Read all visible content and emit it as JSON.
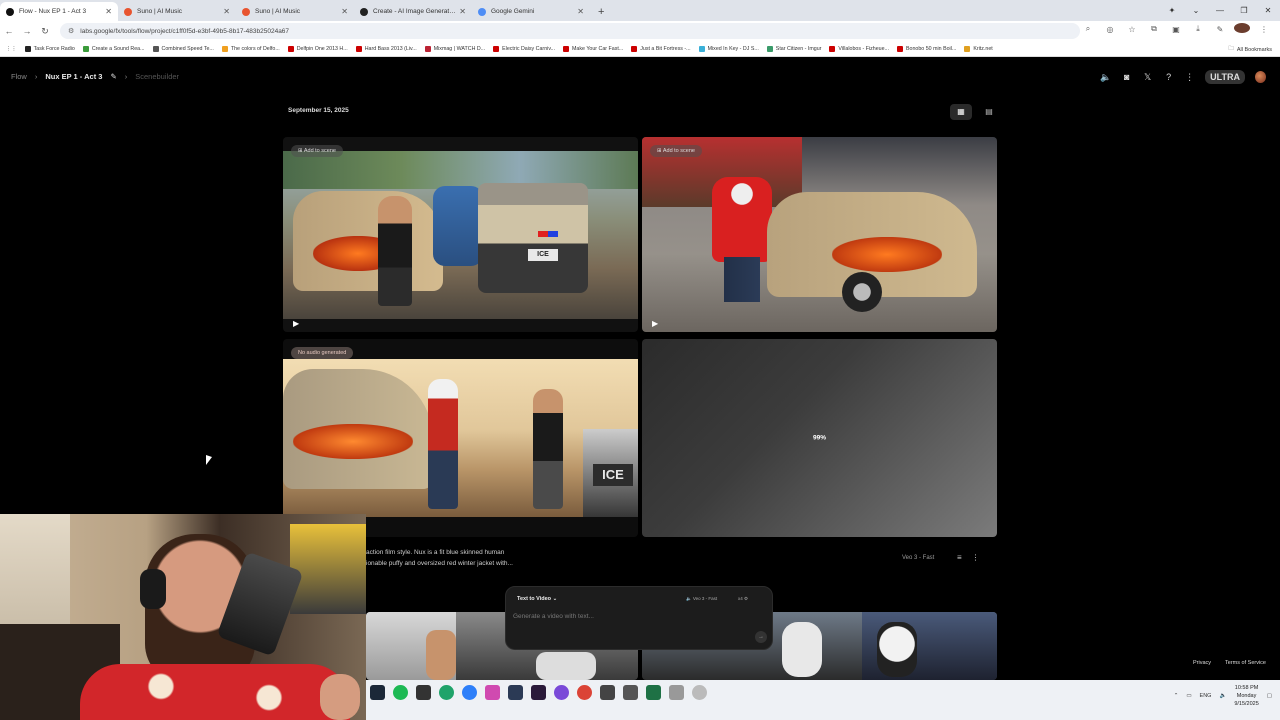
{
  "browser": {
    "tabs": [
      {
        "title": "Flow - Nux EP 1 - Act 3",
        "color": "#111111",
        "active": true
      },
      {
        "title": "Suno | AI Music",
        "color": "#e8542f",
        "active": false
      },
      {
        "title": "Suno | AI Music",
        "color": "#e8542f",
        "active": false
      },
      {
        "title": "Create - AI Image Generator | ...",
        "color": "#222222",
        "active": false
      },
      {
        "title": "Google Gemini",
        "color": "#4e8df5",
        "active": false
      }
    ],
    "new_tab": "+",
    "url": "labs.google/fx/tools/flow/project/c1ff0f5d-e3bf-49b5-8b17-483b25024a67",
    "bookmarks": [
      "Task Force Radio",
      "Create a Sound Rea...",
      "Combined Speed Te...",
      "The colors of Delfo...",
      "Delfpin One 2013 H...",
      "Hard Bass 2013 (Liv...",
      "Mixmag | WATCH D...",
      "Electric Daisy Carniv...",
      "Make Your Car Fast...",
      "Just a Bit Fortress -...",
      "Mixed In Key - DJ S...",
      "Star Citizen - Imgur",
      "Villalobos - Fizheue...",
      "Bonobo 50 min Boil...",
      "Kritz.net"
    ],
    "all_bookmarks": "All Bookmarks"
  },
  "app": {
    "breadcrumb": {
      "root": "Flow",
      "project": "Nux EP 1 - Act 3",
      "section": "Scenebuilder"
    },
    "badge": "ULTRA",
    "date": "September 15, 2025",
    "add_to_scene": "Add to scene",
    "no_audio": "No audio generated",
    "progress": "99%",
    "prompt_line1": "action film style. Nux is a fit blue skinned human",
    "prompt_line2": "ionable puffy and oversized red winter jacket with...",
    "model": "Veo 3 - Fast",
    "composer": {
      "mode": "Text to Video",
      "model": "Veo 3 - Fast",
      "count": "x4",
      "placeholder": "Generate a video with text..."
    },
    "footer": {
      "privacy": "Privacy",
      "terms": "Terms of Service"
    }
  },
  "taskbar": {
    "lang": "ENG",
    "time": "10:58 PM",
    "day": "Monday",
    "date": "9/15/2025"
  }
}
